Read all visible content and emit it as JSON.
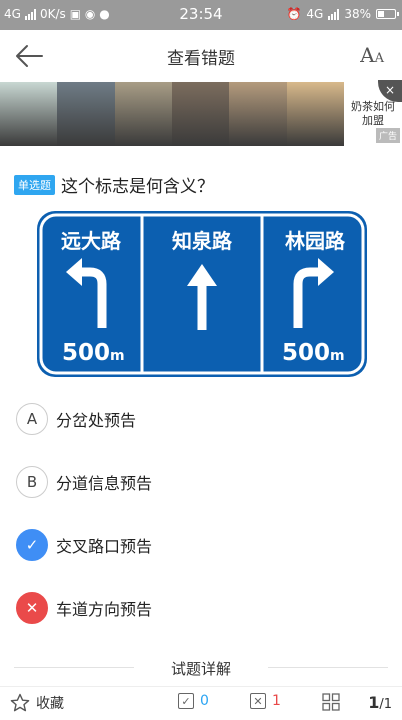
{
  "status_bar": {
    "network": "4G",
    "speed": "0K/s",
    "time": "23:54",
    "network_right": "4G",
    "battery": "38%"
  },
  "header": {
    "title": "查看错题",
    "font_big": "A",
    "font_small": "A"
  },
  "ad": {
    "text": "奶茶如何加盟",
    "tag": "广告",
    "close": "×",
    "photo_colors": [
      "#c8d7d2",
      "#6f7c86",
      "#a89d86",
      "#7c6d5e",
      "#b49b7d",
      "#d8b98b"
    ]
  },
  "question": {
    "tag": "单选题",
    "text": "这个标志是何含义？"
  },
  "sign": {
    "colors": {
      "blue": "#0c5fb0",
      "white": "#ffffff"
    },
    "roads": [
      "远大路",
      "知泉路",
      "林园路"
    ],
    "distance_left": "500",
    "distance_right": "500",
    "unit": "m"
  },
  "options": [
    {
      "letter": "A",
      "text": "分岔处预告",
      "state": "normal"
    },
    {
      "letter": "B",
      "text": "分道信息预告",
      "state": "normal"
    },
    {
      "letter": "✓",
      "text": "交叉路口预告",
      "state": "correct"
    },
    {
      "letter": "✕",
      "text": "车道方向预告",
      "state": "wrong"
    }
  ],
  "explain": {
    "title": "试题详解"
  },
  "bottom_bar": {
    "favorite_label": "收藏",
    "right_count": "0",
    "wrong_count": "1",
    "page_current": "1",
    "page_total": "/1"
  },
  "colors": {
    "accent_blue": "#2fa6f0",
    "correct": "#3f8ef5",
    "wrong": "#ea4a4a"
  }
}
